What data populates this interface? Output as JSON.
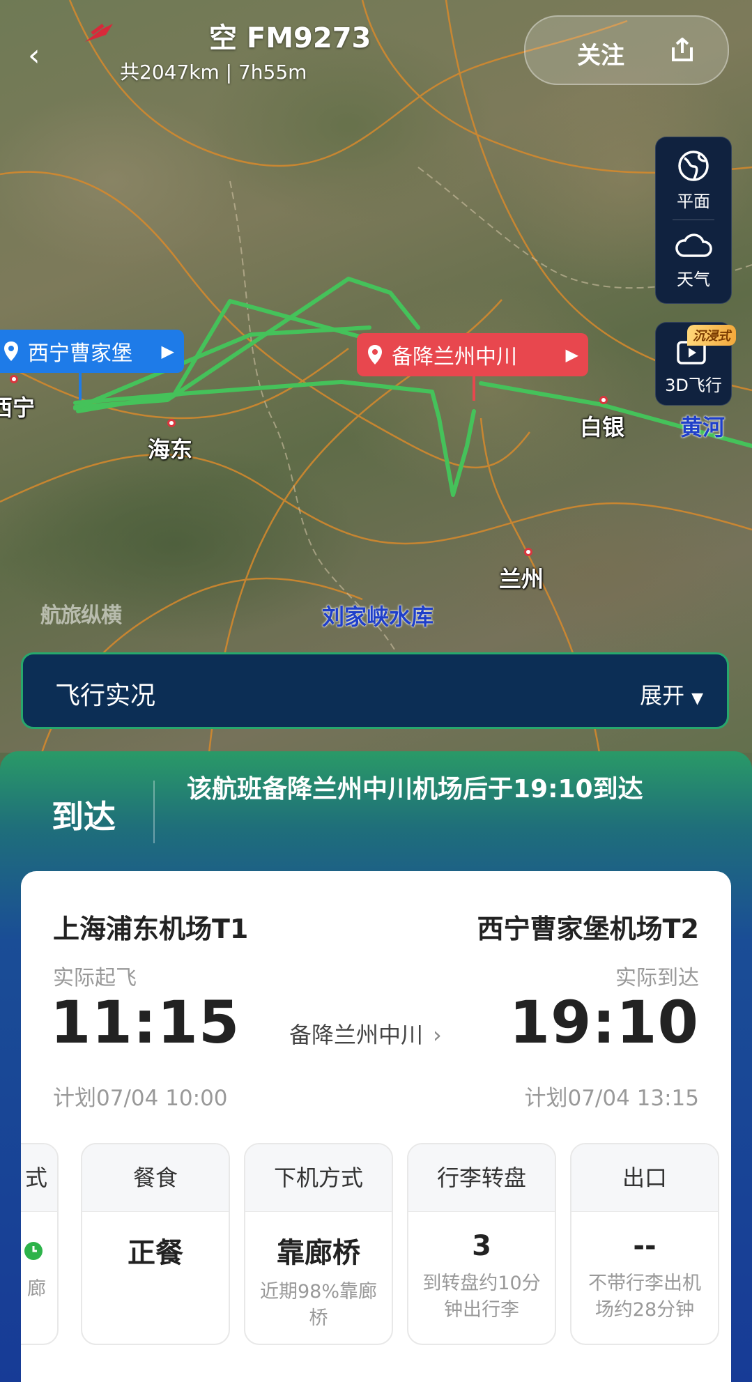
{
  "header": {
    "title": "空 FM9273",
    "subtitle": "共2047km | 7h55m",
    "follow_label": "关注"
  },
  "map": {
    "tools": {
      "flat_label": "平面",
      "weather_label": "天气",
      "fly3d_label": "3D飞行",
      "immersive_badge": "沉浸式"
    },
    "origin_pin": "西宁曹家堡",
    "divert_pin": "备降兰州中川",
    "city_labels": {
      "xining": "西宁",
      "haidong": "海东",
      "baiyin": "白银",
      "lanzhou": "兰州",
      "huanghe": "黄河",
      "reservoir": "刘家峡水库"
    },
    "watermark": "航旅纵横"
  },
  "live_bar": {
    "title": "飞行实况",
    "expand_label": "展开"
  },
  "status": {
    "label": "到达",
    "text": "该航班备降兰州中川机场后于19:10到达"
  },
  "flight": {
    "departure": {
      "airport": "上海浦东机场T1",
      "label": "实际起飞",
      "time": "11:15",
      "planned": "计划07/04 10:00"
    },
    "arrival": {
      "airport": "西宁曹家堡机场T2",
      "label": "实际到达",
      "time": "19:10",
      "planned": "计划07/04 13:15"
    },
    "via": "备降兰州中川"
  },
  "info_tiles": [
    {
      "head": "式",
      "value": "",
      "sub": "廊"
    },
    {
      "head": "餐食",
      "value": "正餐",
      "sub": ""
    },
    {
      "head": "下机方式",
      "value": "靠廊桥",
      "sub": "近期98%靠廊桥"
    },
    {
      "head": "行李转盘",
      "value": "3",
      "sub": "到转盘约10分钟出行李"
    },
    {
      "head": "出口",
      "value": "--",
      "sub": "不带行李出机场约28分钟"
    }
  ],
  "colors": {
    "route_green": "#45c25a",
    "origin_blue": "#1e7be8",
    "divert_red": "#e8474e",
    "live_bar_bg": "#0c2e55",
    "sheet_blue": "#173b96"
  }
}
